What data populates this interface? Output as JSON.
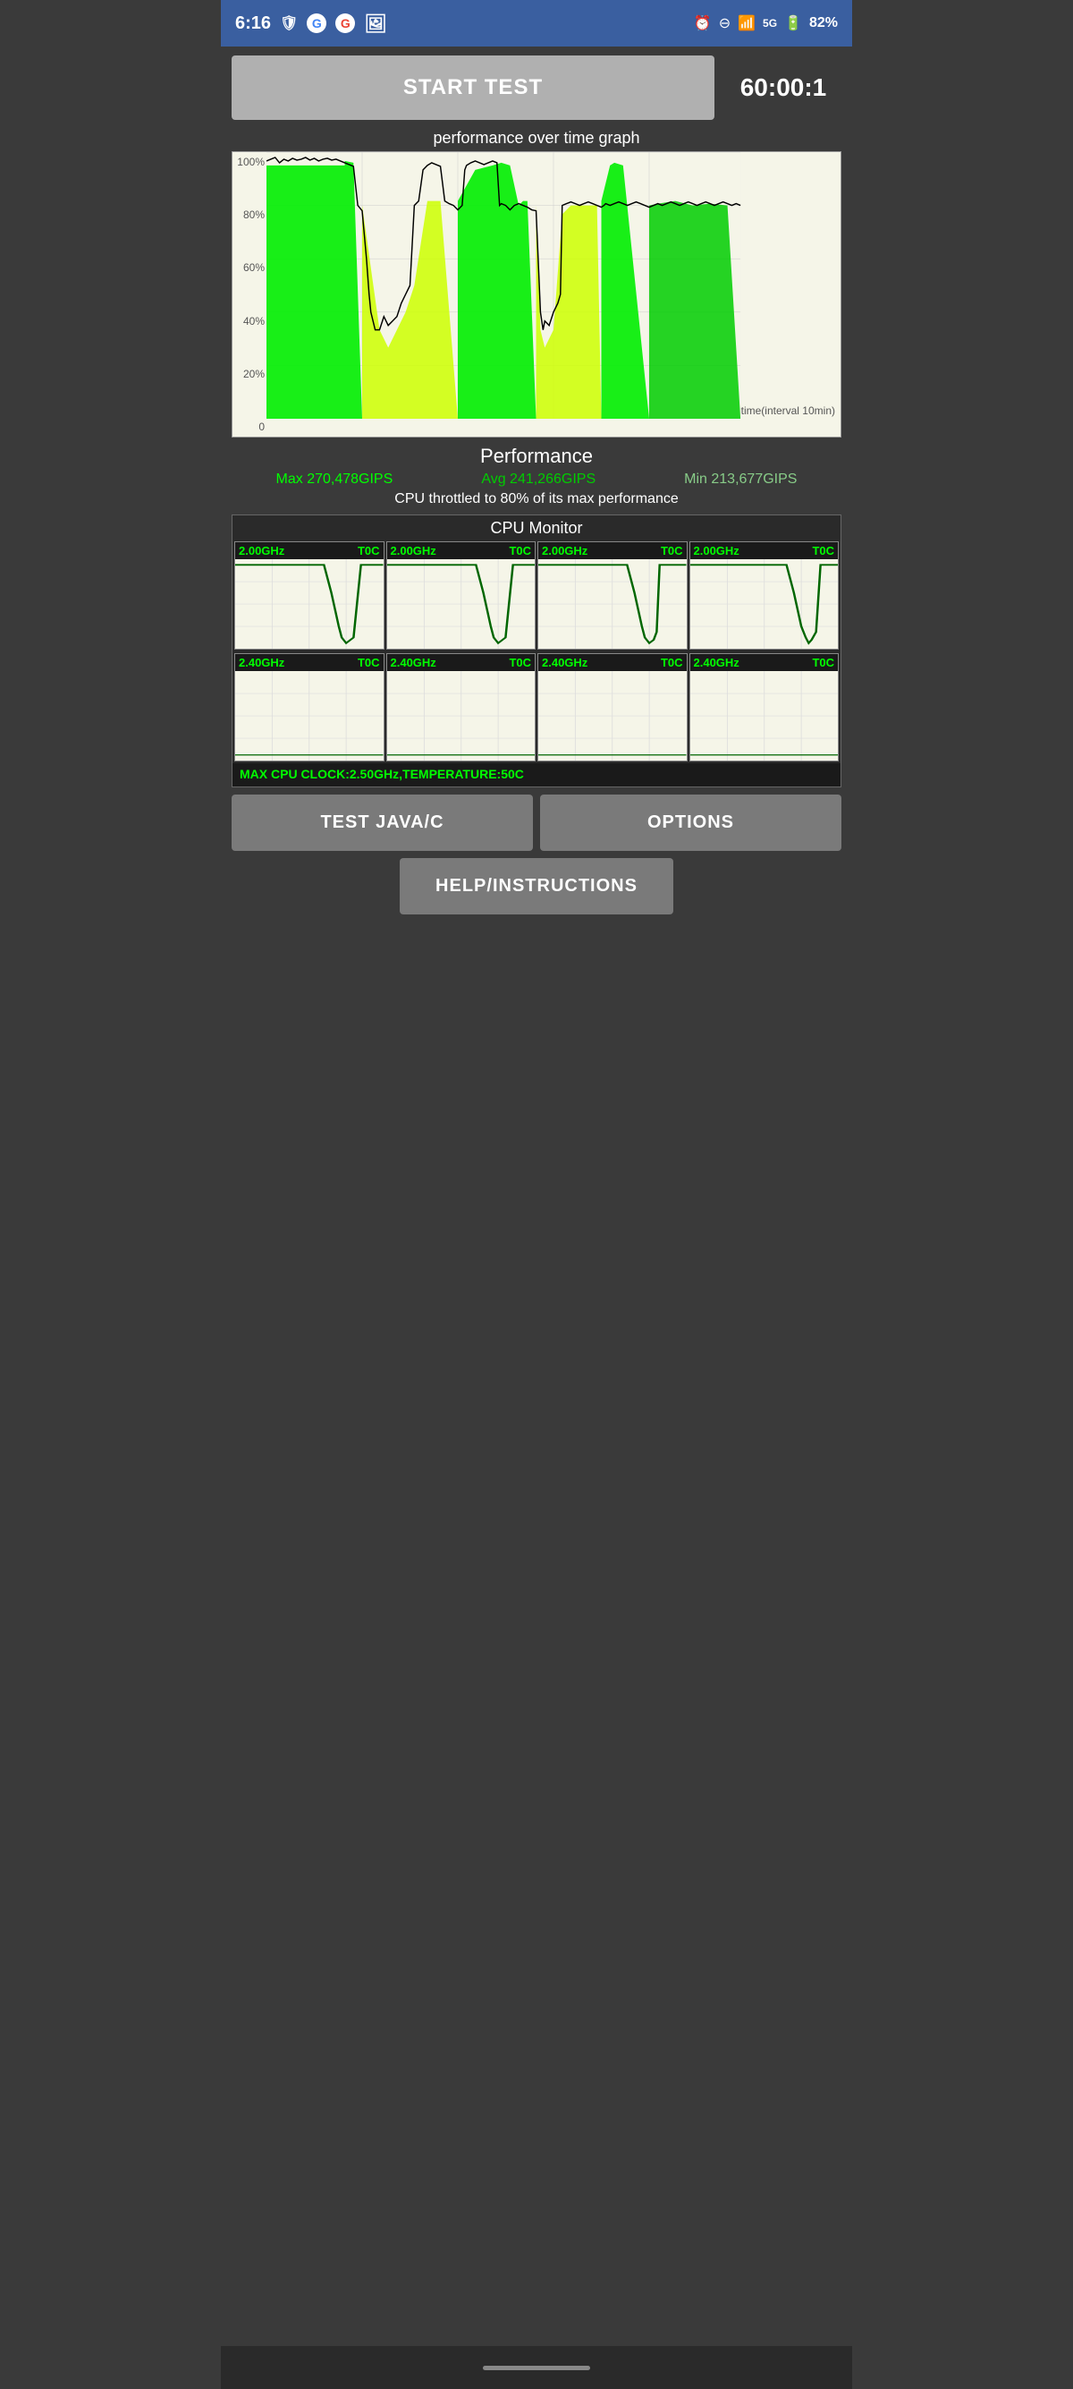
{
  "statusBar": {
    "time": "6:16",
    "battery": "82%",
    "icons": {
      "left": [
        "time",
        "shield",
        "google-g",
        "google-g2",
        "image"
      ],
      "right": [
        "alarm",
        "minus-circle",
        "wifi",
        "5g-signal",
        "battery"
      ]
    }
  },
  "topRow": {
    "startTestLabel": "START TEST",
    "timerDisplay": "60:00:1"
  },
  "performanceGraph": {
    "title": "performance over time graph",
    "yLabels": [
      "100%",
      "80%",
      "60%",
      "40%",
      "20%",
      "0"
    ],
    "xLabel": "time(interval 10min)",
    "accentColor": "#00ff00",
    "yellowColor": "#ccff00"
  },
  "performanceStats": {
    "title": "Performance",
    "max": "Max 270,478GIPS",
    "avg": "Avg 241,266GIPS",
    "min": "Min 213,677GIPS",
    "throttleNote": "CPU throttled to 80% of its max performance"
  },
  "cpuMonitor": {
    "title": "CPU Monitor",
    "topRow": [
      {
        "freq": "2.00GHz",
        "temp": "T0C"
      },
      {
        "freq": "2.00GHz",
        "temp": "T0C"
      },
      {
        "freq": "2.00GHz",
        "temp": "T0C"
      },
      {
        "freq": "2.00GHz",
        "temp": "T0C"
      }
    ],
    "bottomRow": [
      {
        "freq": "2.40GHz",
        "temp": "T0C"
      },
      {
        "freq": "2.40GHz",
        "temp": "T0C"
      },
      {
        "freq": "2.40GHz",
        "temp": "T0C"
      },
      {
        "freq": "2.40GHz",
        "temp": "T0C"
      }
    ],
    "clockInfo": "MAX CPU CLOCK:2.50GHz,TEMPERATURE:50C"
  },
  "buttons": {
    "testJavaC": "TEST JAVA/C",
    "options": "OPTIONS",
    "helpInstructions": "HELP/INSTRUCTIONS"
  }
}
